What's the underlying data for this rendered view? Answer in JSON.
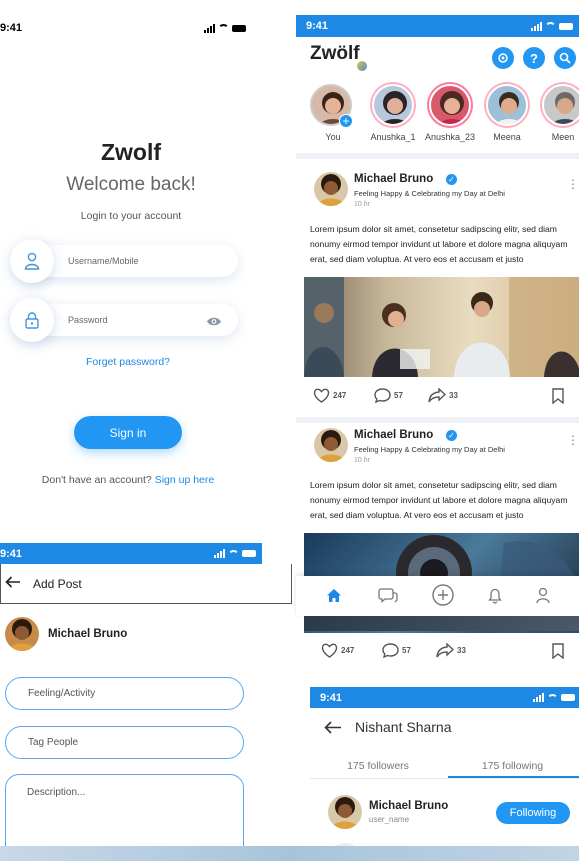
{
  "login": {
    "time": "9:41",
    "app_name": "Zwolf",
    "welcome": "Welcome back!",
    "subtitle": "Login to your account",
    "username_placeholder": "Username/Mobile",
    "password_placeholder": "Password",
    "forgot": "Forget password?",
    "signin": "Sign in",
    "no_account": "Don't have an account?",
    "signup": "Sign up here"
  },
  "add_post": {
    "time": "9:41",
    "title": "Add Post",
    "user": "Michael Bruno",
    "feeling_placeholder": "Feeling/Activity",
    "tag_placeholder": "Tag People",
    "description_placeholder": "Description..."
  },
  "feed": {
    "time": "9:41",
    "logo": "Zwölf",
    "stories": [
      {
        "name": "You"
      },
      {
        "name": "Anushka_1"
      },
      {
        "name": "Anushka_23"
      },
      {
        "name": "Meena"
      },
      {
        "name": "Meen"
      }
    ],
    "posts": [
      {
        "author": "Michael Bruno",
        "status": "Feeling Happy & Celebrating my Day at",
        "place": "Delhi",
        "time": "10 hr",
        "text": "Lorem ipsum dolor sit amet, consetetur sadipscing elitr, sed diam nonumy eirmod tempor invidunt ut labore et dolore magna aliquyam erat, sed diam voluptua. At vero eos et accusam et justo",
        "likes": "247",
        "comments": "57",
        "shares": "33"
      },
      {
        "author": "Michael Bruno",
        "status": "Feeling Happy & Celebrating my Day at",
        "place": "Delhi",
        "time": "10 hr",
        "text": "Lorem ipsum dolor sit amet, consetetur sadipscing elitr, sed diam nonumy eirmod tempor invidunt ut labore et dolore magna aliquyam erat, sed diam voluptua. At vero eos et accusam et justo",
        "likes": "247",
        "comments": "57",
        "shares": "33"
      }
    ]
  },
  "profile": {
    "time": "9:41",
    "name": "Nishant Sharna",
    "followers": "175 followers",
    "following": "175 following",
    "item_name": "Michael Bruno",
    "item_handle": "user_name",
    "follow_btn": "Following"
  },
  "colors": {
    "accent": "#1e88e5",
    "background": "#ffffff"
  },
  "icons": [
    "user-icon",
    "lock-icon",
    "eye-icon",
    "back-arrow-icon",
    "help-icon",
    "search-icon",
    "home-icon",
    "chat-icon",
    "plus-icon",
    "bell-icon",
    "profile-icon",
    "heart-icon",
    "comment-icon",
    "share-icon",
    "bookmark-icon",
    "verified-icon",
    "more-icon"
  ]
}
